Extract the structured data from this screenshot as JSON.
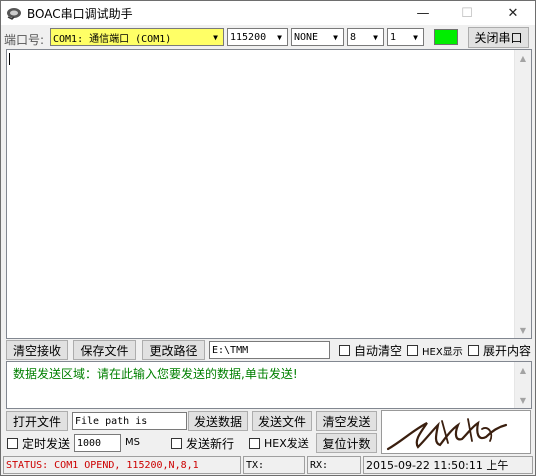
{
  "app": {
    "title": "BOAC串口调试助手",
    "colors": {
      "port_select_bg": "#ffff66",
      "indicator": "#00ee00",
      "send_hint_text": "#008000",
      "status_text": "#cc0000"
    }
  },
  "titlebar": {
    "icon": "app-icon",
    "minimize": "—",
    "maximize": "☐",
    "close": "✕"
  },
  "toolbar": {
    "port_label": "端口号:",
    "port_value": "COM1: 通信端口 (COM1)",
    "baud_value": "115200",
    "parity_value": "NONE",
    "databits_value": "8",
    "stopbits_value": "1",
    "close_port_label": "关闭串口"
  },
  "receive": {
    "clear_label": "清空接收",
    "save_file_label": "保存文件",
    "change_path_label": "更改路径",
    "path_value": "E:\\TMM",
    "auto_clear_label": "自动清空",
    "hex_display_label": "HEX显示",
    "expand_label": "展开内容"
  },
  "send": {
    "hint_text": "数据发送区域：请在此输入您要发送的数据,单击发送!",
    "open_file_label": "打开文件",
    "file_path_value": "File path is",
    "send_data_label": "发送数据",
    "send_file_label": "发送文件",
    "clear_send_label": "清空发送",
    "timed_send_label": "定时发送",
    "interval_value": "1000",
    "interval_unit": "MS",
    "send_newline_label": "发送新行",
    "hex_send_label": "HEX发送",
    "reset_count_label": "复位计数"
  },
  "status": {
    "status_text": "STATUS: COM1 OPEND, 115200,N,8,1",
    "tx_label": "TX:",
    "rx_label": "RX:",
    "datetime": "2015-09-22  11:50:11 上午"
  }
}
